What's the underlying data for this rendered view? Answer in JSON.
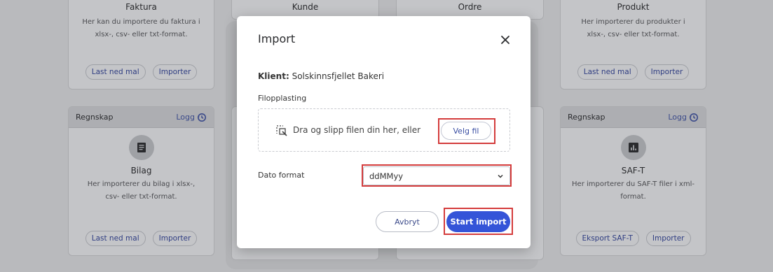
{
  "background_cards": {
    "top": [
      {
        "title": "Faktura",
        "desc": "Her kan du importere du faktura i xlsx-, csv- eller txt-format.",
        "btn1": "Last ned mal",
        "btn2": "Importer"
      },
      {
        "title": "Kunde"
      },
      {
        "title": "Ordre"
      },
      {
        "title": "Produkt",
        "desc": "Her importerer du produkter i xlsx-, csv- eller txt-format.",
        "btn1": "Last ned mal",
        "btn2": "Importer"
      }
    ],
    "bottom": [
      {
        "category": "Regnskap",
        "logg": "Logg",
        "title": "Bilag",
        "desc": "Her importerer du bilag i xlsx-, csv- eller txt-format.",
        "btn1": "Last ned mal",
        "btn2": "Importer"
      },
      {
        "category": "Regnskap",
        "logg": "Logg",
        "title": "SAF-T",
        "desc": "Her importerer du SAF-T filer i xml-format.",
        "btn1": "Eksport SAF-T",
        "btn2": "Importer"
      }
    ]
  },
  "modal": {
    "title": "Import",
    "client_label": "Klient:",
    "client_name": "Solskinnsfjellet Bakeri",
    "upload_label": "Filopplasting",
    "drop_text": "Dra og slipp filen din her, eller",
    "choose_file": "Velg fil",
    "date_label": "Dato format",
    "date_value": "ddMMyy",
    "cancel": "Avbryt",
    "start": "Start import"
  },
  "colors": {
    "primary": "#3454d8",
    "highlight": "#d43c3c"
  }
}
